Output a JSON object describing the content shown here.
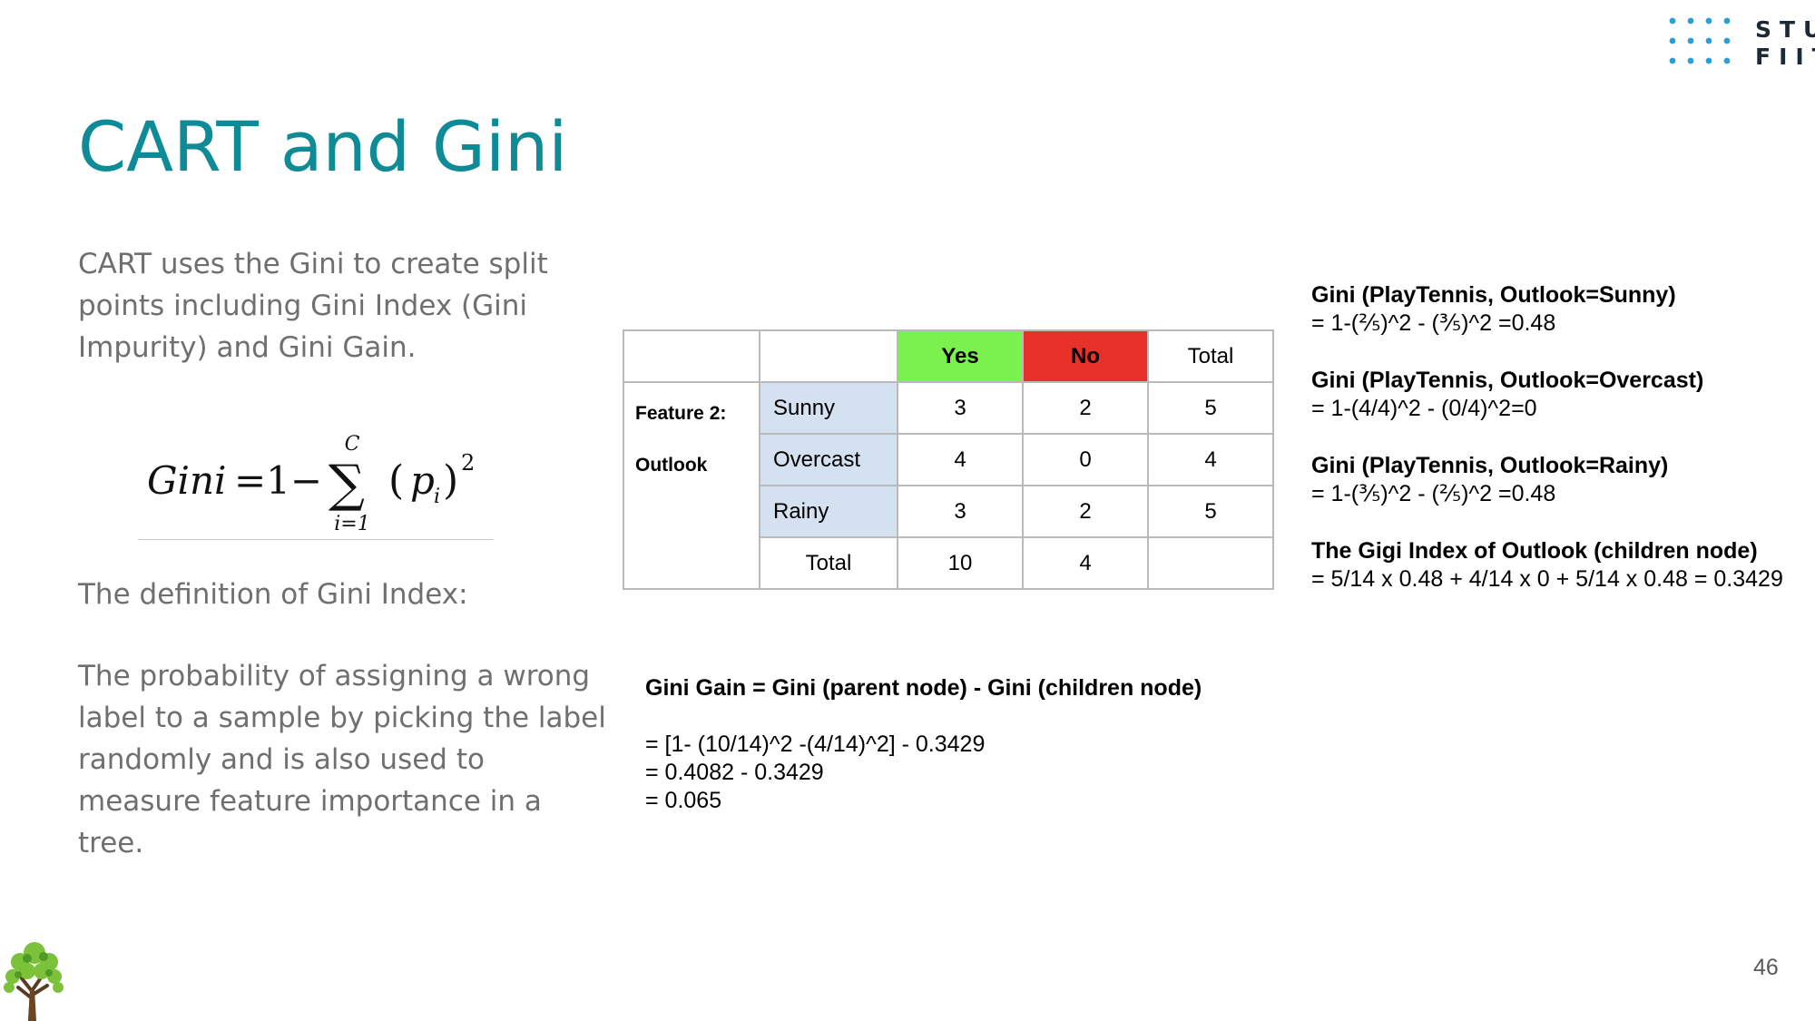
{
  "logo": {
    "line1": "STU",
    "line2": "FIIT"
  },
  "title": "CART and Gini",
  "intro": "CART uses the Gini to create split points including Gini Index (Gini Impurity) and Gini Gain.",
  "formula": {
    "lhs": "Gini",
    "eq": "=1−",
    "sigma": "∑",
    "upper": "C",
    "lower": "i=1",
    "term_open": "(",
    "p": "p",
    "sub": "i",
    "term_close": ")",
    "power": "2"
  },
  "definition_title": "The definition of Gini Index:",
  "definition_body": "The probability of assigning a wrong label to a sample by picking the label randomly and is also used to measure feature importance in a tree.",
  "table": {
    "headers": {
      "yes": "Yes",
      "no": "No",
      "total": "Total"
    },
    "feature_label_line1": "Feature 2:",
    "feature_label_line2": "Outlook",
    "rows": [
      {
        "label": "Sunny",
        "yes": "3",
        "no": "2",
        "total": "5"
      },
      {
        "label": "Overcast",
        "yes": "4",
        "no": "0",
        "total": "4"
      },
      {
        "label": "Rainy",
        "yes": "3",
        "no": "2",
        "total": "5"
      }
    ],
    "totals": {
      "label": "Total",
      "yes": "10",
      "no": "4",
      "total": ""
    },
    "colors": {
      "yes_bg": "#7bf14e",
      "no_bg": "#e7312a",
      "category_bg": "#d3e1f1"
    }
  },
  "calculations": [
    {
      "heading": "Gini (PlayTennis, Outlook=Sunny)",
      "value": "= 1-(⅖)^2 - (⅗)^2 =0.48"
    },
    {
      "heading": "Gini (PlayTennis, Outlook=Overcast)",
      "value": "= 1-(4/4)^2 - (0/4)^2=0"
    },
    {
      "heading": "Gini (PlayTennis, Outlook=Rainy)",
      "value": "= 1-(⅗)^2 - (⅖)^2 =0.48"
    },
    {
      "heading": "The Gigi Index of Outlook (children node)",
      "value": "= 5/14 x 0.48 + 4/14 x 0 + 5/14 x 0.48 = 0.3429"
    }
  ],
  "gain": {
    "heading": "Gini Gain = Gini (parent node) - Gini (children node)",
    "lines": [
      "= [1- (10/14)^2 -(4/14)^2] - 0.3429",
      "= 0.4082 - 0.3429",
      "= 0.065"
    ]
  },
  "page_number": "46",
  "icons": {
    "logo_dots": "dot-grid",
    "tree": "tree-icon"
  },
  "theme": {
    "title_color": "#0e8b97",
    "logo_dot_color": "#2a9fd6"
  }
}
